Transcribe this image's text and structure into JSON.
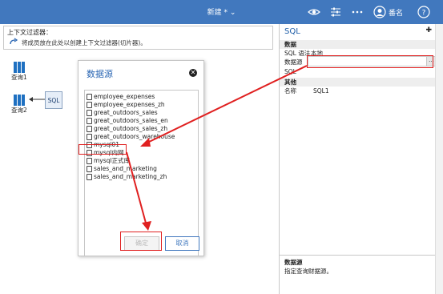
{
  "header": {
    "title": "新建 *",
    "share_label": "番名"
  },
  "filter_bar": {
    "title": "上下文过滤器：",
    "hint": "将成员放在此处以创建上下文过滤器(切片器)。"
  },
  "canvas": {
    "items": [
      {
        "label": "查询1"
      },
      {
        "label": "查询2"
      }
    ],
    "sql_label": "SQL"
  },
  "dialog": {
    "title": "数据源",
    "items": [
      "employee_expenses",
      "employee_expenses_zh",
      "great_outdoors_sales",
      "great_outdoors_sales_en",
      "great_outdoors_sales_zh",
      "great_outdoors_warehouse",
      "mysql01",
      "mysql内网",
      "mysql正式库",
      "sales_and_marketing",
      "sales_and_marketing_zh"
    ],
    "ok_label": "确定",
    "cancel_label": "取消"
  },
  "properties": {
    "title": "SQL",
    "section_data": "数据",
    "rows_data": [
      {
        "key": "SQL 语法",
        "value": "本地"
      },
      {
        "key": "数据源",
        "value": ""
      },
      {
        "key": "SQL",
        "value": ""
      }
    ],
    "section_other": "其他",
    "rows_other": [
      {
        "key": "名称",
        "value": "SQL1"
      }
    ],
    "ds_button": "...",
    "footer_title": "数据源",
    "footer_desc": "指定查询财据源。"
  },
  "colors": {
    "topbar": "#4178be",
    "highlight": "#e02020",
    "link": "#2a66b3"
  }
}
